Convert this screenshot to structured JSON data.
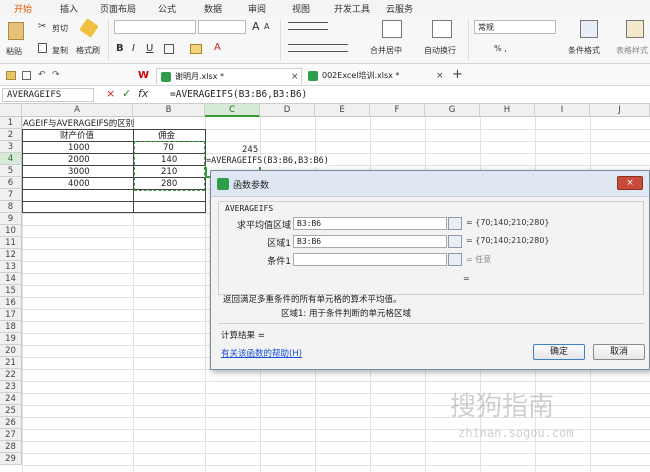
{
  "ribbon_tabs": [
    "开始",
    "插入",
    "页面布局",
    "公式",
    "数据",
    "审阅",
    "视图",
    "开发工具",
    "云服务"
  ],
  "ribbon": {
    "paste": "粘贴",
    "cut": "剪切",
    "copy": "复制",
    "format_painter": "格式刷",
    "bold": "B",
    "italic": "I",
    "underline": "U",
    "font_grow": "A",
    "font_shrink": "A",
    "merge_center": "合并居中",
    "auto_wrap": "自动换行",
    "number_format": "常规",
    "number_btns": "% ,",
    "cond_format": "条件格式",
    "table_style": "表格样式"
  },
  "doc_tabs": [
    {
      "label": "谢明月.xlsx *",
      "close": "×"
    },
    {
      "label": "002Excel培训.xlsx *",
      "close": "×"
    }
  ],
  "new_tab": "+",
  "formula_bar": {
    "name_box": "AVERAGEIFS",
    "cancel": "×",
    "confirm": "✓",
    "fx": "fx",
    "formula": "=AVERAGEIFS(B3:B6,B3:B6)"
  },
  "columns": [
    "A",
    "B",
    "C",
    "D",
    "E",
    "F",
    "G",
    "H",
    "I",
    "J"
  ],
  "rows": [
    "1",
    "2",
    "3",
    "4",
    "5",
    "6",
    "7",
    "8",
    "9",
    "10",
    "11",
    "12",
    "13",
    "14",
    "15",
    "16",
    "17",
    "18",
    "19",
    "20",
    "21",
    "22",
    "23",
    "24",
    "25",
    "26",
    "27",
    "28",
    "29"
  ],
  "cells": {
    "A1": "AGEIF与AVERAGEIFS的区别",
    "A2": "财产价值",
    "B2": "佣金",
    "A3": "1000",
    "B3": "70",
    "A4": "2000",
    "B4": "140",
    "A5": "3000",
    "B5": "210",
    "A6": "4000",
    "B6": "280",
    "D3": "245",
    "C4": "=AVERAGEIFS(B3:B6,B3:B6)"
  },
  "dialog": {
    "title": "函数参数",
    "close": "×",
    "function_name": "AVERAGEIFS",
    "fields": [
      {
        "label": "求平均值区域",
        "value": "B3:B6",
        "result": "= {70;140;210;280}"
      },
      {
        "label": "区域1",
        "value": "B3:B6",
        "result": "= {70;140;210;280}"
      },
      {
        "label": "条件1",
        "value": "",
        "result": "= 任意"
      }
    ],
    "eq_sign": "=",
    "description": "返回满足多重条件的所有单元格的算术平均值。",
    "param_help": "区域1:   用于条件判断的单元格区域",
    "calc_result": "计算结果 =",
    "help_link": "有关该函数的帮助(H)",
    "ok": "确定",
    "cancel": "取消"
  },
  "watermark": {
    "brand": "搜狗指南",
    "url": "zhinan.sogou.com"
  },
  "colors": {
    "accent": "#e05a00",
    "selection": "#3b9c3b",
    "link": "#1a4fd6"
  }
}
